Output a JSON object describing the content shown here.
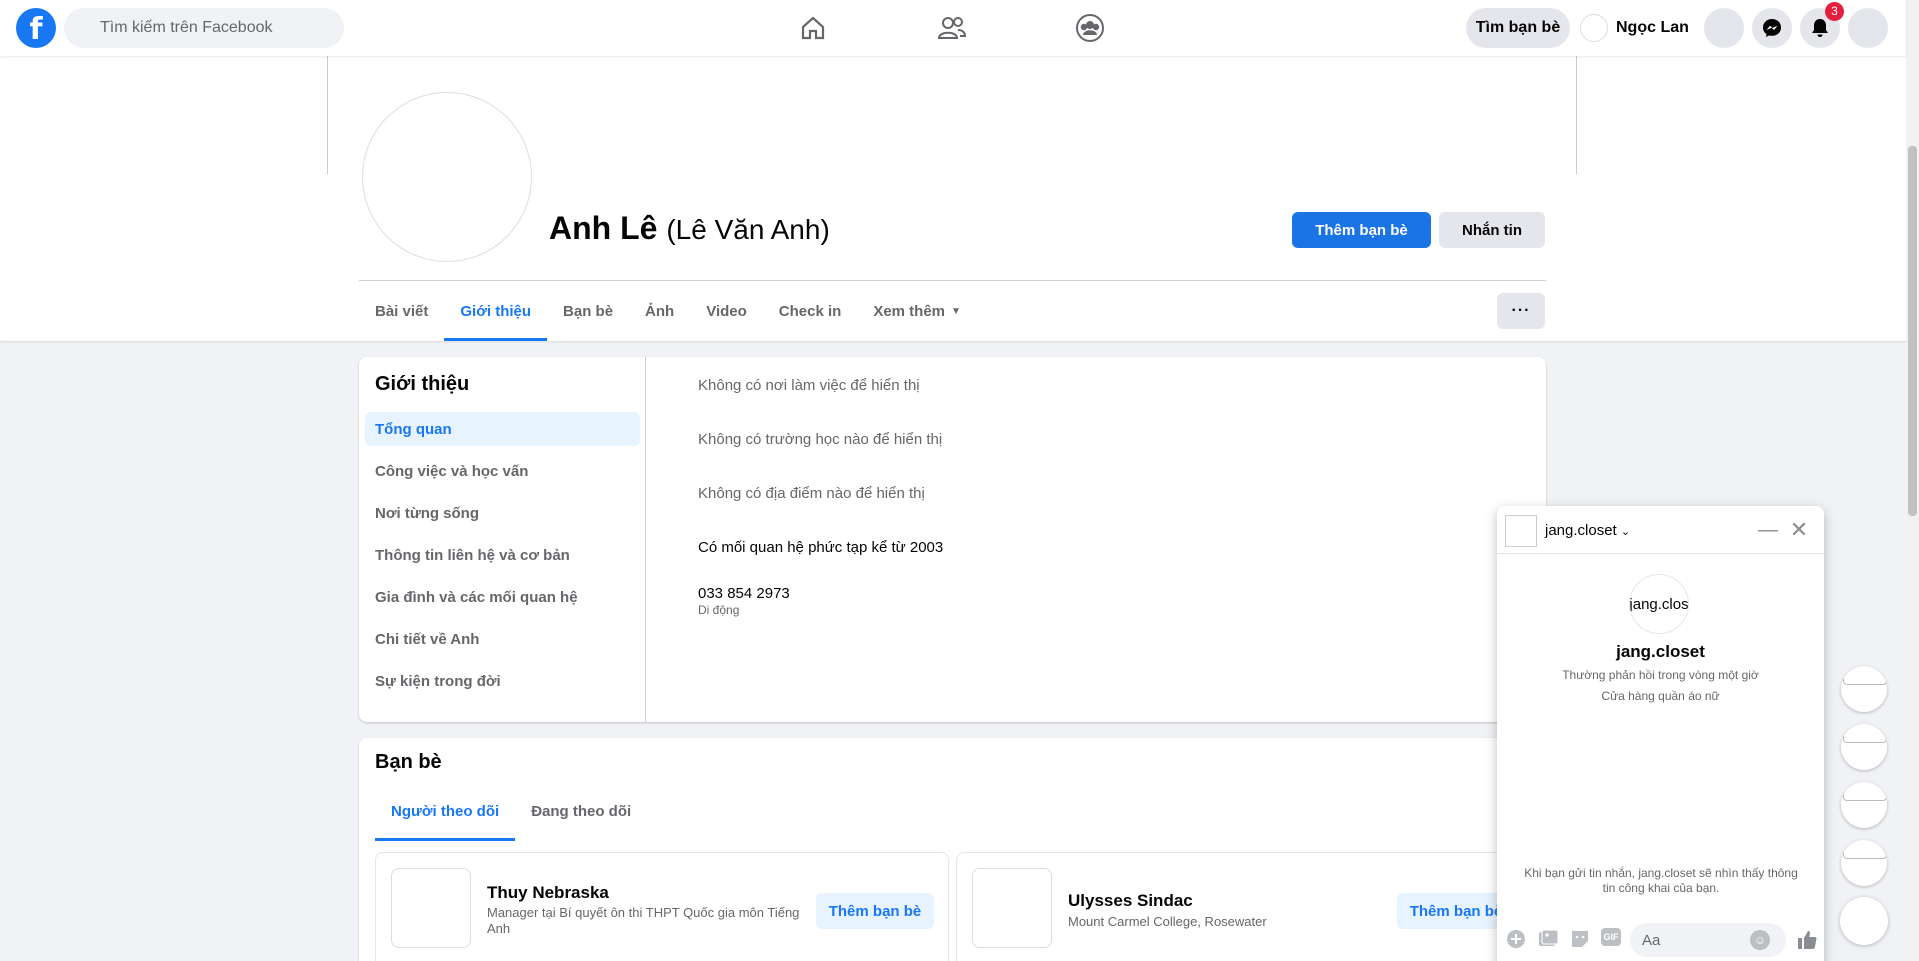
{
  "topbar": {
    "search_placeholder": "Tìm kiếm trên Facebook",
    "find_friends_label": "Tìm bạn bè",
    "user_name": "Ngọc Lan",
    "notification_count": "3",
    "brand_color": "#1877f2"
  },
  "profile": {
    "name": "Anh Lê",
    "alternate_name": "(Lê Văn Anh)",
    "add_friend_label": "Thêm bạn bè",
    "message_label": "Nhắn tin",
    "more_label": "···"
  },
  "tabs": [
    {
      "label": "Bài viết"
    },
    {
      "label": "Giới thiệu",
      "active": true
    },
    {
      "label": "Bạn bè"
    },
    {
      "label": "Ảnh"
    },
    {
      "label": "Video"
    },
    {
      "label": "Check in"
    },
    {
      "label": "Xem thêm"
    }
  ],
  "about": {
    "title": "Giới thiệu",
    "menu": [
      {
        "label": "Tổng quan",
        "active": true
      },
      {
        "label": "Công việc và học vấn"
      },
      {
        "label": "Nơi từng sống"
      },
      {
        "label": "Thông tin liên hệ và cơ bản"
      },
      {
        "label": "Gia đình và các mối quan hệ"
      },
      {
        "label": "Chi tiết về Anh"
      },
      {
        "label": "Sự kiện trong đời"
      }
    ],
    "work": "Không có nơi làm việc để hiển thị",
    "school": "Không có trường học nào để hiển thị",
    "places": "Không có địa điểm nào để hiển thị",
    "relationship": "Có mối quan hệ phức tạp kể từ 2003",
    "phone": "033 854 2973",
    "phone_type": "Di động"
  },
  "friends": {
    "title": "Bạn bè",
    "tabs": [
      {
        "label": "Người theo dõi",
        "active": true
      },
      {
        "label": "Đang theo dõi"
      }
    ],
    "items": [
      {
        "name": "Thuy Nebraska",
        "desc": "Manager tại Bí quyết ôn thi THPT Quốc gia môn Tiếng Anh",
        "button": "Thêm bạn bè"
      },
      {
        "name": "Ulysses Sindac",
        "desc": "Mount Carmel College, Rosewater",
        "button": "Thêm bạn bè"
      }
    ]
  },
  "chat": {
    "name": "jang.closet",
    "avatar_alt": "jang.clos",
    "response_time": "Thường phản hồi trong vòng một giờ",
    "category": "Cửa hàng quần áo nữ",
    "notice": "Khi bạn gửi tin nhắn, jang.closet sẽ nhìn thấy thông tin công khai của bạn.",
    "input_placeholder": "Aa",
    "gif_label": "GIF"
  }
}
